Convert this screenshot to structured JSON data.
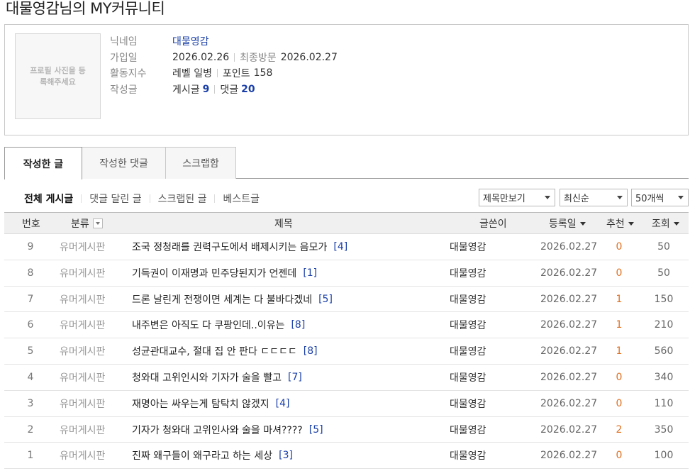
{
  "page_title": "대물영감님의 MY커뮤니티",
  "profile": {
    "photo_placeholder": "프로필 사진을 등록해주세요",
    "nickname_label": "닉네임",
    "nickname": "대물영감",
    "joined_label": "가입일",
    "joined": "2026.02.26",
    "last_visit_label": "최종방문",
    "last_visit": "2026.02.27",
    "activity_label": "활동지수",
    "level": "레벨 일병",
    "points_label": "포인트",
    "points": "158",
    "posts_label": "작성글",
    "posts_text": "게시글",
    "posts_count": "9",
    "comments_text": "댓글",
    "comments_count": "20"
  },
  "tabs": [
    {
      "label": "작성한 글",
      "active": true
    },
    {
      "label": "작성한 댓글",
      "active": false
    },
    {
      "label": "스크랩함",
      "active": false
    }
  ],
  "filters": [
    {
      "label": "전체 게시글",
      "active": true
    },
    {
      "label": "댓글 달린 글",
      "active": false
    },
    {
      "label": "스크랩된 글",
      "active": false
    },
    {
      "label": "베스트글",
      "active": false
    }
  ],
  "selects": {
    "view_mode": "제목만보기",
    "sort": "최신순",
    "per_page": "50개씩"
  },
  "table": {
    "headers": {
      "no": "번호",
      "category": "분류",
      "title": "제목",
      "author": "글쓴이",
      "date": "등록일",
      "recommend": "추천",
      "views": "조회"
    },
    "rows": [
      {
        "no": "9",
        "category": "유머게시판",
        "title": "조국 정청래를 권력구도에서 배제시키는 음모가",
        "comments": "[4]",
        "author": "대물영감",
        "date": "2026.02.27",
        "recommend": "0",
        "views": "50"
      },
      {
        "no": "8",
        "category": "유머게시판",
        "title": "기득권이 이재명과 민주당된지가 언젠데",
        "comments": "[1]",
        "author": "대물영감",
        "date": "2026.02.27",
        "recommend": "0",
        "views": "50"
      },
      {
        "no": "7",
        "category": "유머게시판",
        "title": "드론 날린게 전쟁이면 세계는 다 불바다겠네",
        "comments": "[5]",
        "author": "대물영감",
        "date": "2026.02.27",
        "recommend": "1",
        "views": "150"
      },
      {
        "no": "6",
        "category": "유머게시판",
        "title": "내주변은 아직도 다 쿠팡인데..이유는",
        "comments": "[8]",
        "author": "대물영감",
        "date": "2026.02.27",
        "recommend": "1",
        "views": "210"
      },
      {
        "no": "5",
        "category": "유머게시판",
        "title": "성균관대교수, 절대 집 안 판다 ㄷㄷㄷㄷ",
        "comments": "[8]",
        "author": "대물영감",
        "date": "2026.02.27",
        "recommend": "1",
        "views": "560"
      },
      {
        "no": "4",
        "category": "유머게시판",
        "title": "청와대 고위인시와 기자가 술을 빨고",
        "comments": "[7]",
        "author": "대물영감",
        "date": "2026.02.27",
        "recommend": "0",
        "views": "340"
      },
      {
        "no": "3",
        "category": "유머게시판",
        "title": "재명아는 싸우는게 탐탁치 않겠지",
        "comments": "[4]",
        "author": "대물영감",
        "date": "2026.02.27",
        "recommend": "0",
        "views": "110"
      },
      {
        "no": "2",
        "category": "유머게시판",
        "title": "기자가 청와대 고위인사와 술을 마셔????",
        "comments": "[5]",
        "author": "대물영감",
        "date": "2026.02.27",
        "recommend": "2",
        "views": "350"
      },
      {
        "no": "1",
        "category": "유머게시판",
        "title": "진짜 왜구들이 왜구라고 하는 세상",
        "comments": "[3]",
        "author": "대물영감",
        "date": "2026.02.27",
        "recommend": "0",
        "views": "100"
      }
    ]
  }
}
